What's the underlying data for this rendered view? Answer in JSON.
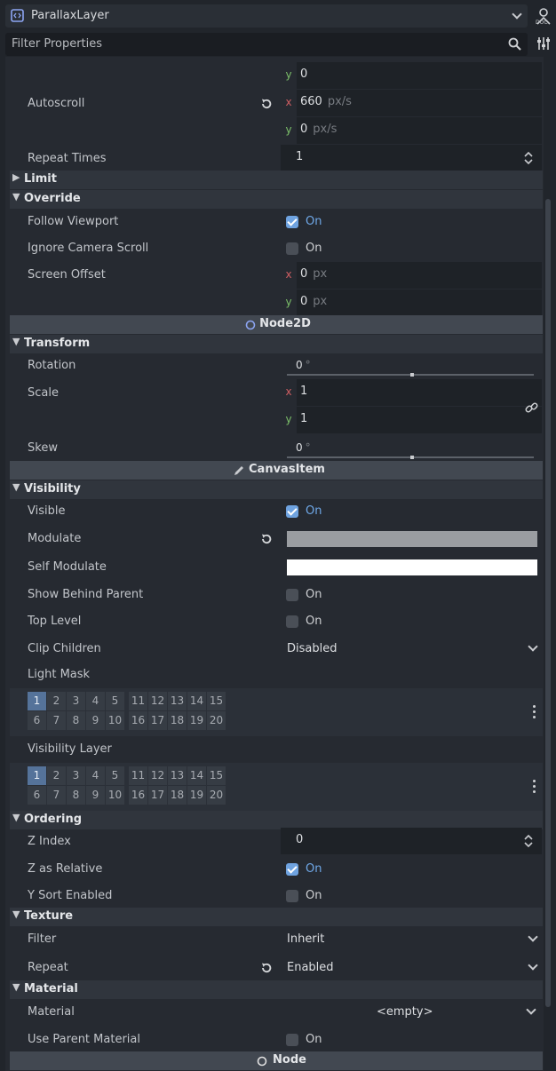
{
  "header": {
    "object_name": "ParallaxLayer",
    "filter_placeholder": "Filter Properties"
  },
  "autoscroll_section": {
    "prev_y": {
      "axis": "y",
      "value": "0"
    },
    "autoscroll": {
      "label": "Autoscroll",
      "x": "660",
      "y": "0",
      "unit": "px/s"
    },
    "repeat_times": {
      "label": "Repeat Times",
      "value": "1"
    }
  },
  "sections": {
    "limit": "Limit",
    "override": "Override",
    "node2d": "Node2D",
    "transform": "Transform",
    "canvasitem": "CanvasItem",
    "visibility": "Visibility",
    "ordering": "Ordering",
    "texture": "Texture",
    "material": "Material",
    "node": "Node"
  },
  "override": {
    "follow_viewport": {
      "label": "Follow Viewport",
      "checked": true,
      "text": "On"
    },
    "ignore_camera_scroll": {
      "label": "Ignore Camera Scroll",
      "checked": false,
      "text": "On"
    },
    "screen_offset": {
      "label": "Screen Offset",
      "x": "0",
      "y": "0",
      "unit": "px"
    }
  },
  "transform": {
    "rotation": {
      "label": "Rotation",
      "value": "0",
      "unit": "°"
    },
    "scale": {
      "label": "Scale",
      "x": "1",
      "y": "1"
    },
    "skew": {
      "label": "Skew",
      "value": "0",
      "unit": "°"
    }
  },
  "visibility": {
    "visible": {
      "label": "Visible",
      "checked": true,
      "text": "On"
    },
    "modulate": {
      "label": "Modulate",
      "color": "#9a9da1"
    },
    "self_modulate": {
      "label": "Self Modulate",
      "color": "#ffffff"
    },
    "show_behind_parent": {
      "label": "Show Behind Parent",
      "checked": false,
      "text": "On"
    },
    "top_level": {
      "label": "Top Level",
      "checked": false,
      "text": "On"
    },
    "clip_children": {
      "label": "Clip Children",
      "value": "Disabled"
    },
    "light_mask": {
      "label": "Light Mask",
      "active_layers": [
        1
      ]
    },
    "visibility_layer": {
      "label": "Visibility Layer",
      "active_layers": [
        1
      ]
    }
  },
  "layer_numbers": {
    "row1a": [
      "1",
      "2",
      "3",
      "4",
      "5"
    ],
    "row1b": [
      "11",
      "12",
      "13",
      "14",
      "15"
    ],
    "row2a": [
      "6",
      "7",
      "8",
      "9",
      "10"
    ],
    "row2b": [
      "16",
      "17",
      "18",
      "19",
      "20"
    ]
  },
  "ordering": {
    "z_index": {
      "label": "Z Index",
      "value": "0"
    },
    "z_as_relative": {
      "label": "Z as Relative",
      "checked": true,
      "text": "On"
    },
    "y_sort_enabled": {
      "label": "Y Sort Enabled",
      "checked": false,
      "text": "On"
    }
  },
  "texture": {
    "filter": {
      "label": "Filter",
      "value": "Inherit"
    },
    "repeat": {
      "label": "Repeat",
      "value": "Enabled"
    }
  },
  "material": {
    "material": {
      "label": "Material",
      "value": "<empty>"
    },
    "use_parent_material": {
      "label": "Use Parent Material",
      "checked": false,
      "text": "On"
    }
  },
  "colors": {
    "accent": "#6fa8e8",
    "axis_x": "#cf5e62",
    "axis_y": "#7cc06a",
    "active_layer": "#55739a"
  }
}
